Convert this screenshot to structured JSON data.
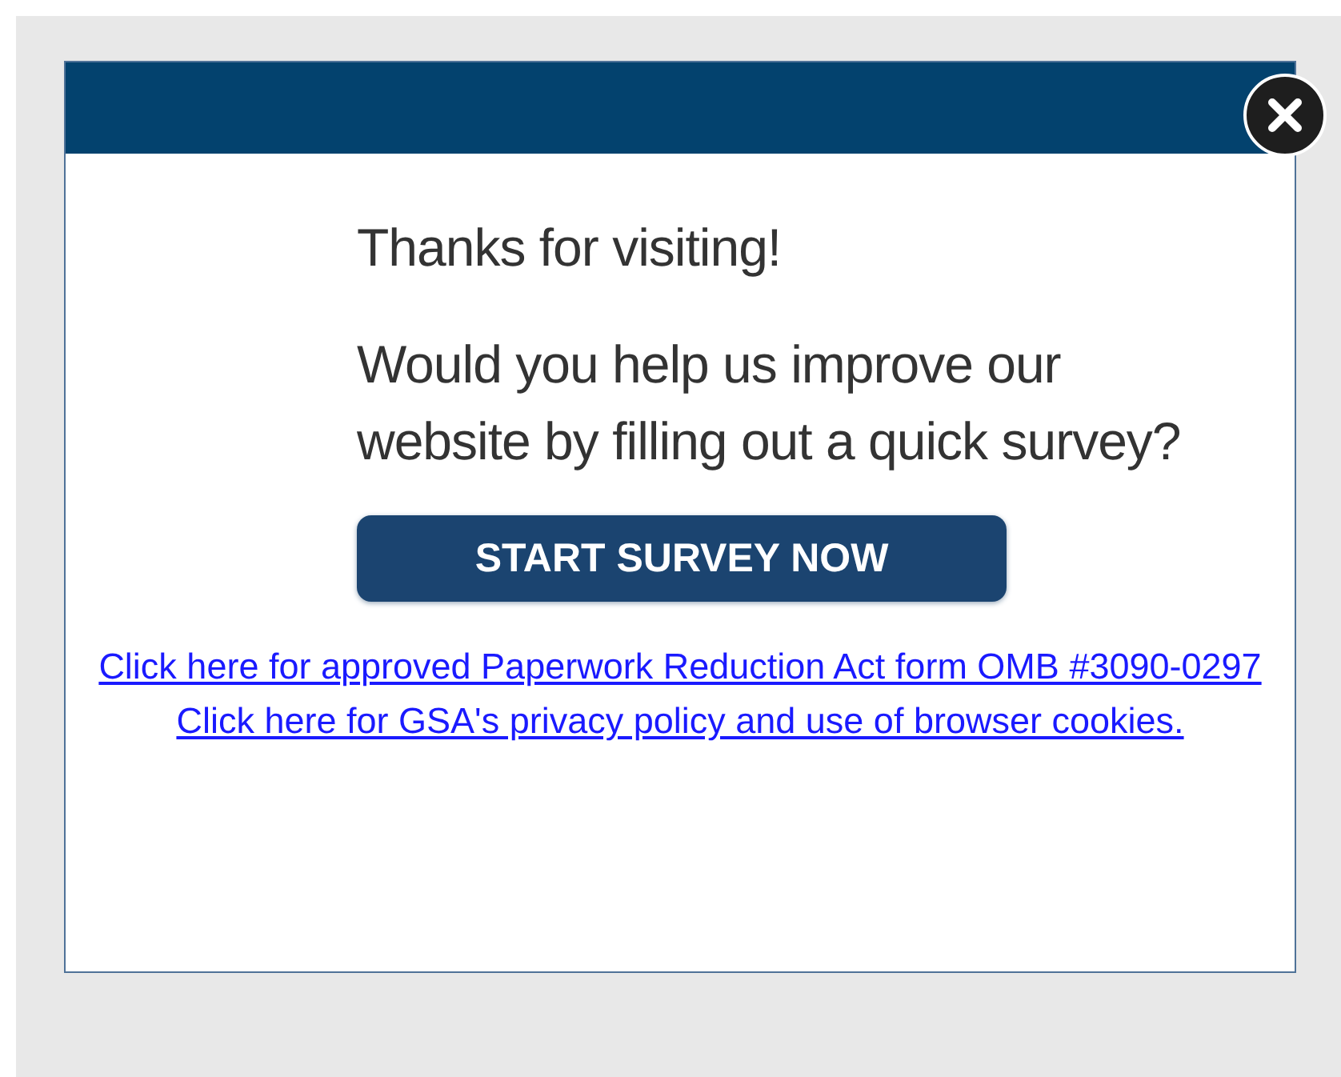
{
  "dialog": {
    "heading": "Thanks for visiting!",
    "question": "Would you help us improve our website by filling out a quick survey?",
    "button": "START SURVEY NOW",
    "links": [
      "Click here for approved Paperwork Reduction Act form OMB #3090-0297",
      "Click here for GSA's privacy policy and use of browser cookies."
    ]
  }
}
